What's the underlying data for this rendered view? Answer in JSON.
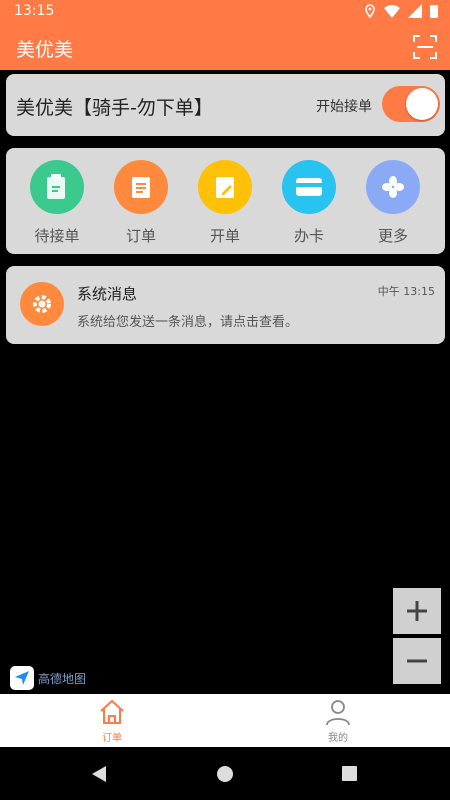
{
  "status_bar": {
    "time": "13:15"
  },
  "app_bar": {
    "title": "美优美"
  },
  "shop_card": {
    "name": "美优美【骑手-勿下单】",
    "toggle_label": "开始接单",
    "toggle_on": true
  },
  "menu": {
    "items": [
      {
        "label": "待接单",
        "icon": "pending-orders-icon",
        "color": "#3cc98e"
      },
      {
        "label": "订单",
        "icon": "order-list-icon",
        "color": "#ff8a3d"
      },
      {
        "label": "开单",
        "icon": "create-order-icon",
        "color": "#ffc107"
      },
      {
        "label": "办卡",
        "icon": "card-icon",
        "color": "#29c3f0"
      },
      {
        "label": "更多",
        "icon": "more-icon",
        "color": "#8aaaf5"
      }
    ]
  },
  "message": {
    "title": "系统消息",
    "time": "中午 13:15",
    "body": "系统给您发送一条消息，请点击查看。"
  },
  "map": {
    "logo_text": "高德地图"
  },
  "bottom_nav": {
    "order_label": "订单",
    "mine_label": "我的",
    "active": "订单"
  },
  "colors": {
    "accent": "#ff7a45"
  }
}
